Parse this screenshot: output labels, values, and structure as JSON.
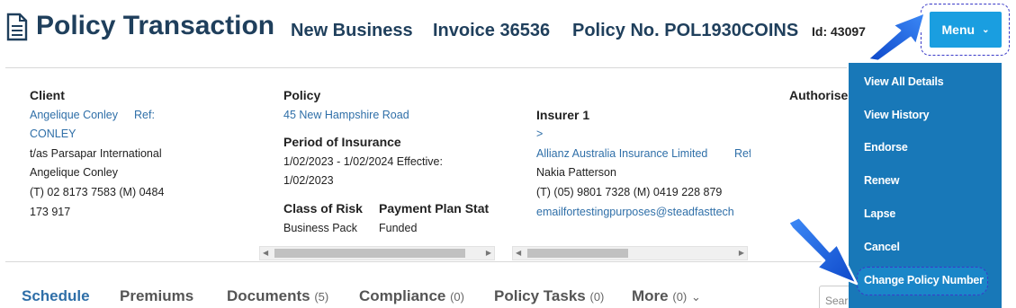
{
  "header": {
    "title": "Policy Transaction",
    "transaction_type": "New Business",
    "invoice": "Invoice 36536",
    "policy_no": "Policy No. POL1930COINS",
    "id": "Id: 43097"
  },
  "menu": {
    "label": "Menu",
    "items": [
      "View All Details",
      "View History",
      "Endorse",
      "Renew",
      "Lapse",
      "Cancel",
      "Change Policy Number"
    ]
  },
  "client": {
    "heading": "Client",
    "name_link": "Angelique Conley",
    "ref_link_a": "Ref:",
    "ref_link_b": "CONLEY",
    "trading_as": "t/as Parsapar International",
    "contact": "Angelique Conley",
    "phone_line1": "(T) 02 8173 7583   (M) 0484",
    "phone_line2": "173 917"
  },
  "policy": {
    "heading": "Policy",
    "address_link": "45 New Hampshire Road",
    "period_heading": "Period of Insurance",
    "period_line1": "1/02/2023 - 1/02/2024   Effective:",
    "period_line2": "1/02/2023",
    "class_heading": "Class of Risk",
    "class_value": "Business Pack",
    "payment_heading": "Payment Plan Stat",
    "payment_value": "Funded"
  },
  "insurer": {
    "heading": "Insurer 1",
    "arrow_link": ">",
    "name_link": "Allianz Australia Insurance Limited",
    "ref_link": "Ref",
    "contact": "Nakia Patterson",
    "phone": "(T) (05) 9801 7328   (M) 0419 228 879",
    "email_link": "emailfortestingpurposes@steadfasttech"
  },
  "authorised": {
    "heading": "Authorise"
  },
  "tabs": [
    {
      "label": "Schedule",
      "count": ""
    },
    {
      "label": "Premiums",
      "count": ""
    },
    {
      "label": "Documents",
      "count": "(5)"
    },
    {
      "label": "Compliance",
      "count": "(0)"
    },
    {
      "label": "Policy Tasks",
      "count": "(0)"
    },
    {
      "label": "More",
      "count": "(0)"
    }
  ],
  "search": {
    "placeholder": "Sear"
  },
  "colors": {
    "accent": "#1a9ee0",
    "dropdown": "#1878b8",
    "title": "#1f3f5c",
    "link": "#2f6fa8"
  }
}
